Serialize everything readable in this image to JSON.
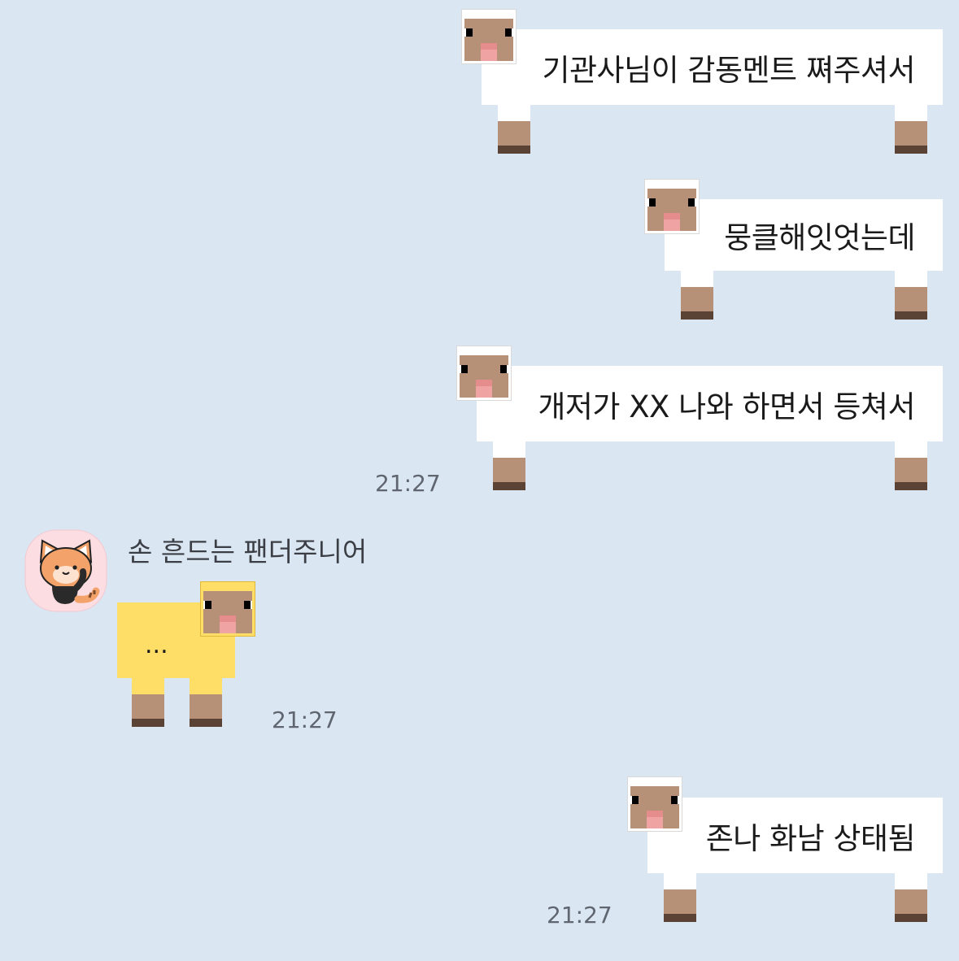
{
  "chat": {
    "messages": [
      {
        "side": "sent",
        "text": "기관사님이 감동멘트 쪄주셔서",
        "time": ""
      },
      {
        "side": "sent",
        "text": "뭉클해잇엇는데",
        "time": ""
      },
      {
        "side": "sent",
        "text": "개저가 XX 나와 하면서 등쳐서",
        "time": "21:27"
      },
      {
        "side": "received",
        "sender": "손 흔드는 팬더주니어",
        "text": "...",
        "time": "21:27"
      },
      {
        "side": "sent",
        "text": "존나 화남 상태됨",
        "time": "21:27"
      }
    ]
  },
  "icons": {
    "sheep_bubble": "sheep-icon",
    "avatar": "red-panda-avatar-icon"
  },
  "colors": {
    "background": "#dbe6f3",
    "sent_bubble": "#ffffff",
    "received_bubble": "#fede66",
    "sheep_face": "#b69177",
    "hoof": "#5a4334",
    "nose": "#f0a3a3",
    "avatar_bg": "#fbdde2"
  }
}
